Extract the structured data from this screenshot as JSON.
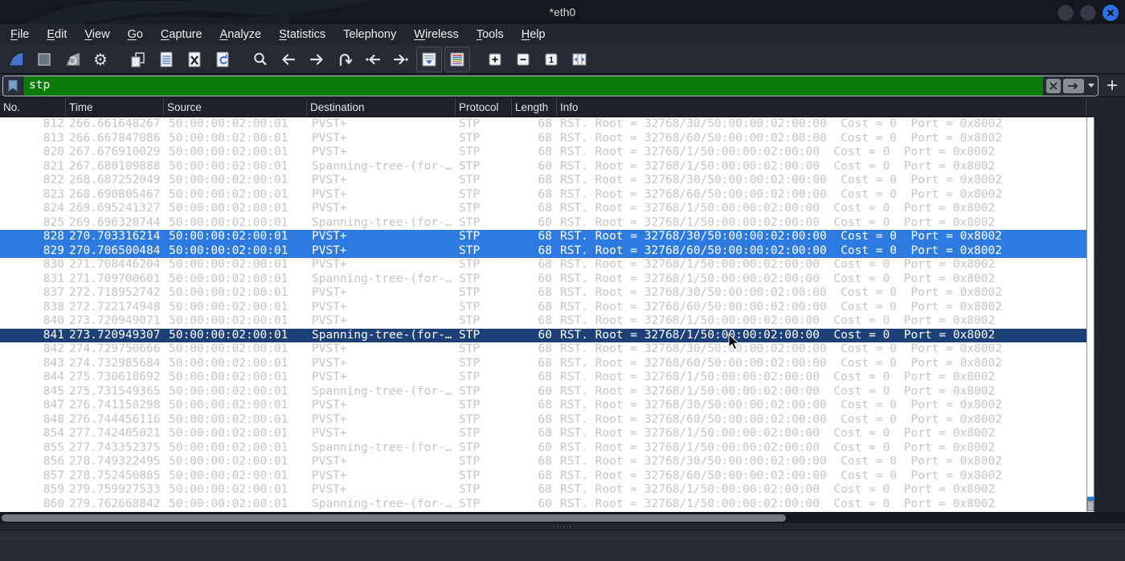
{
  "window": {
    "title": "*eth0",
    "controls": [
      "minimize",
      "maximize",
      "close"
    ]
  },
  "menu_bar": {
    "items": [
      {
        "label": "File",
        "underline_first": true
      },
      {
        "label": "Edit",
        "underline_first": true
      },
      {
        "label": "View",
        "underline_first": true
      },
      {
        "label": "Go",
        "underline_first": true
      },
      {
        "label": "Capture",
        "underline_first": true
      },
      {
        "label": "Analyze",
        "underline_first": true
      },
      {
        "label": "Statistics",
        "underline_first": true
      },
      {
        "label": "Telephony",
        "underline_first": false
      },
      {
        "label": "Wireless",
        "underline_first": true
      },
      {
        "label": "Tools",
        "underline_first": true
      },
      {
        "label": "Help",
        "underline_first": true
      }
    ]
  },
  "toolbar": {
    "buttons": [
      {
        "name": "start-capture"
      },
      {
        "name": "stop-capture"
      },
      {
        "name": "restart-capture"
      },
      {
        "name": "capture-options"
      },
      {
        "sep": true
      },
      {
        "name": "open-file"
      },
      {
        "name": "save-file"
      },
      {
        "name": "close-file"
      },
      {
        "name": "reload-file"
      },
      {
        "sep": true
      },
      {
        "name": "find-packet"
      },
      {
        "name": "go-back"
      },
      {
        "name": "go-forward"
      },
      {
        "name": "go-to-packet"
      },
      {
        "name": "go-first"
      },
      {
        "name": "go-last"
      },
      {
        "name": "auto-scroll",
        "checked": true
      },
      {
        "name": "colorize",
        "checked": true
      },
      {
        "sep": true
      },
      {
        "name": "zoom-in"
      },
      {
        "name": "zoom-out"
      },
      {
        "name": "zoom-100"
      },
      {
        "name": "resize-columns"
      }
    ]
  },
  "filter_bar": {
    "value": "stp",
    "valid_color": "#0a7a0a",
    "icons": [
      "bookmark-icon",
      "clear-filter-icon",
      "apply-filter-icon",
      "dropdown-caret-icon"
    ],
    "add_button_label": "+"
  },
  "packet_list": {
    "columns": [
      "No.",
      "Time",
      "Source",
      "Destination",
      "Protocol",
      "Length",
      "Info"
    ],
    "rows": [
      {
        "no": "812",
        "time": "266.661648267",
        "source": "50:00:00:02:00:01",
        "destination": "PVST+",
        "protocol": "STP",
        "length": "68",
        "info": "RST. Root = 32768/30/50:00:00:02:00:00  Cost = 0  Port = 0x8002",
        "state": ""
      },
      {
        "no": "813",
        "time": "266.667847086",
        "source": "50:00:00:02:00:01",
        "destination": "PVST+",
        "protocol": "STP",
        "length": "68",
        "info": "RST. Root = 32768/60/50:00:00:02:00:00  Cost = 0  Port = 0x8002",
        "state": ""
      },
      {
        "no": "820",
        "time": "267.676910029",
        "source": "50:00:00:02:00:01",
        "destination": "PVST+",
        "protocol": "STP",
        "length": "68",
        "info": "RST. Root = 32768/1/50:00:00:02:00:00  Cost = 0  Port = 0x8002",
        "state": ""
      },
      {
        "no": "821",
        "time": "267.680109888",
        "source": "50:00:00:02:00:01",
        "destination": "Spanning-tree-(for-…",
        "protocol": "STP",
        "length": "60",
        "info": "RST. Root = 32768/1/50:00:00:02:00:00  Cost = 0  Port = 0x8002",
        "state": ""
      },
      {
        "no": "822",
        "time": "268.687252049",
        "source": "50:00:00:02:00:01",
        "destination": "PVST+",
        "protocol": "STP",
        "length": "68",
        "info": "RST. Root = 32768/30/50:00:00:02:00:00  Cost = 0  Port = 0x8002",
        "state": ""
      },
      {
        "no": "823",
        "time": "268.690805467",
        "source": "50:00:00:02:00:01",
        "destination": "PVST+",
        "protocol": "STP",
        "length": "68",
        "info": "RST. Root = 32768/60/50:00:00:02:00:00  Cost = 0  Port = 0x8002",
        "state": ""
      },
      {
        "no": "824",
        "time": "269.695241327",
        "source": "50:00:00:02:00:01",
        "destination": "PVST+",
        "protocol": "STP",
        "length": "68",
        "info": "RST. Root = 32768/1/50:00:00:02:00:00  Cost = 0  Port = 0x8002",
        "state": ""
      },
      {
        "no": "825",
        "time": "269.696328744",
        "source": "50:00:00:02:00:01",
        "destination": "Spanning-tree-(for-…",
        "protocol": "STP",
        "length": "60",
        "info": "RST. Root = 32768/1/50:00:00:02:00:00  Cost = 0  Port = 0x8002",
        "state": ""
      },
      {
        "no": "828",
        "time": "270.703316214",
        "source": "50:00:00:02:00:01",
        "destination": "PVST+",
        "protocol": "STP",
        "length": "68",
        "info": "RST. Root = 32768/30/50:00:00:02:00:00  Cost = 0  Port = 0x8002",
        "state": "selected"
      },
      {
        "no": "829",
        "time": "270.706500484",
        "source": "50:00:00:02:00:01",
        "destination": "PVST+",
        "protocol": "STP",
        "length": "68",
        "info": "RST. Root = 32768/60/50:00:00:02:00:00  Cost = 0  Port = 0x8002",
        "state": "selected"
      },
      {
        "no": "830",
        "time": "271.708446204",
        "source": "50:00:00:02:00:01",
        "destination": "PVST+",
        "protocol": "STP",
        "length": "68",
        "info": "RST. Root = 32768/1/50:00:00:02:00:00  Cost = 0  Port = 0x8002",
        "state": ""
      },
      {
        "no": "831",
        "time": "271.709700601",
        "source": "50:00:00:02:00:01",
        "destination": "Spanning-tree-(for-…",
        "protocol": "STP",
        "length": "60",
        "info": "RST. Root = 32768/1/50:00:00:02:00:00  Cost = 0  Port = 0x8002",
        "state": ""
      },
      {
        "no": "837",
        "time": "272.718952742",
        "source": "50:00:00:02:00:01",
        "destination": "PVST+",
        "protocol": "STP",
        "length": "68",
        "info": "RST. Root = 32768/30/50:00:00:02:00:00  Cost = 0  Port = 0x8002",
        "state": ""
      },
      {
        "no": "838",
        "time": "272.722174948",
        "source": "50:00:00:02:00:01",
        "destination": "PVST+",
        "protocol": "STP",
        "length": "68",
        "info": "RST. Root = 32768/60/50:00:00:02:00:00  Cost = 0  Port = 0x8002",
        "state": ""
      },
      {
        "no": "840",
        "time": "273.720949071",
        "source": "50:00:00:02:00:01",
        "destination": "PVST+",
        "protocol": "STP",
        "length": "68",
        "info": "RST. Root = 32768/1/50:00:00:02:00:00  Cost = 0  Port = 0x8002",
        "state": ""
      },
      {
        "no": "841",
        "time": "273.720949307",
        "source": "50:00:00:02:00:01",
        "destination": "Spanning-tree-(for-…",
        "protocol": "STP",
        "length": "60",
        "info": "RST. Root = 32768/1/50:00:00:02:00:00  Cost = 0  Port = 0x8002",
        "state": "current"
      },
      {
        "no": "842",
        "time": "274.729750666",
        "source": "50:00:00:02:00:01",
        "destination": "PVST+",
        "protocol": "STP",
        "length": "68",
        "info": "RST. Root = 32768/30/50:00:00:02:00:00  Cost = 0  Port = 0x8002",
        "state": ""
      },
      {
        "no": "843",
        "time": "274.732985684",
        "source": "50:00:00:02:00:01",
        "destination": "PVST+",
        "protocol": "STP",
        "length": "68",
        "info": "RST. Root = 32768/60/50:00:00:02:00:00  Cost = 0  Port = 0x8002",
        "state": ""
      },
      {
        "no": "844",
        "time": "275.730618692",
        "source": "50:00:00:02:00:01",
        "destination": "PVST+",
        "protocol": "STP",
        "length": "68",
        "info": "RST. Root = 32768/1/50:00:00:02:00:00  Cost = 0  Port = 0x8002",
        "state": ""
      },
      {
        "no": "845",
        "time": "275.731549365",
        "source": "50:00:00:02:00:01",
        "destination": "Spanning-tree-(for-…",
        "protocol": "STP",
        "length": "60",
        "info": "RST. Root = 32768/1/50:00:00:02:00:00  Cost = 0  Port = 0x8002",
        "state": ""
      },
      {
        "no": "847",
        "time": "276.741158298",
        "source": "50:00:00:02:00:01",
        "destination": "PVST+",
        "protocol": "STP",
        "length": "68",
        "info": "RST. Root = 32768/30/50:00:00:02:00:00  Cost = 0  Port = 0x8002",
        "state": ""
      },
      {
        "no": "848",
        "time": "276.744456116",
        "source": "50:00:00:02:00:01",
        "destination": "PVST+",
        "protocol": "STP",
        "length": "68",
        "info": "RST. Root = 32768/60/50:00:00:02:00:00  Cost = 0  Port = 0x8002",
        "state": ""
      },
      {
        "no": "854",
        "time": "277.742405021",
        "source": "50:00:00:02:00:01",
        "destination": "PVST+",
        "protocol": "STP",
        "length": "68",
        "info": "RST. Root = 32768/1/50:00:00:02:00:00  Cost = 0  Port = 0x8002",
        "state": ""
      },
      {
        "no": "855",
        "time": "277.743352375",
        "source": "50:00:00:02:00:01",
        "destination": "Spanning-tree-(for-…",
        "protocol": "STP",
        "length": "60",
        "info": "RST. Root = 32768/1/50:00:00:02:00:00  Cost = 0  Port = 0x8002",
        "state": ""
      },
      {
        "no": "856",
        "time": "278.749322495",
        "source": "50:00:00:02:00:01",
        "destination": "PVST+",
        "protocol": "STP",
        "length": "68",
        "info": "RST. Root = 32768/30/50:00:00:02:00:00  Cost = 0  Port = 0x8002",
        "state": ""
      },
      {
        "no": "857",
        "time": "278.752450885",
        "source": "50:00:00:02:00:01",
        "destination": "PVST+",
        "protocol": "STP",
        "length": "68",
        "info": "RST. Root = 32768/60/50:00:00:02:00:00  Cost = 0  Port = 0x8002",
        "state": ""
      },
      {
        "no": "859",
        "time": "279.759927533",
        "source": "50:00:00:02:00:01",
        "destination": "PVST+",
        "protocol": "STP",
        "length": "68",
        "info": "RST. Root = 32768/1/50:00:00:02:00:00  Cost = 0  Port = 0x8002",
        "state": ""
      },
      {
        "no": "860",
        "time": "279.762668842",
        "source": "50:00:00:02:00:01",
        "destination": "Spanning-tree-(for-…",
        "protocol": "STP",
        "length": "60",
        "info": "RST. Root = 32768/1/50:00:00:02:00:00  Cost = 0  Port = 0x8002",
        "state": ""
      }
    ]
  },
  "colors": {
    "selected_row": "#2d7ae1",
    "current_row": "#1e4078",
    "filter_valid_green": "#0a7a0a",
    "titlebar_bg": "#14171e",
    "chrome_bg": "#262a33",
    "row_text": "#c4c4c4"
  }
}
